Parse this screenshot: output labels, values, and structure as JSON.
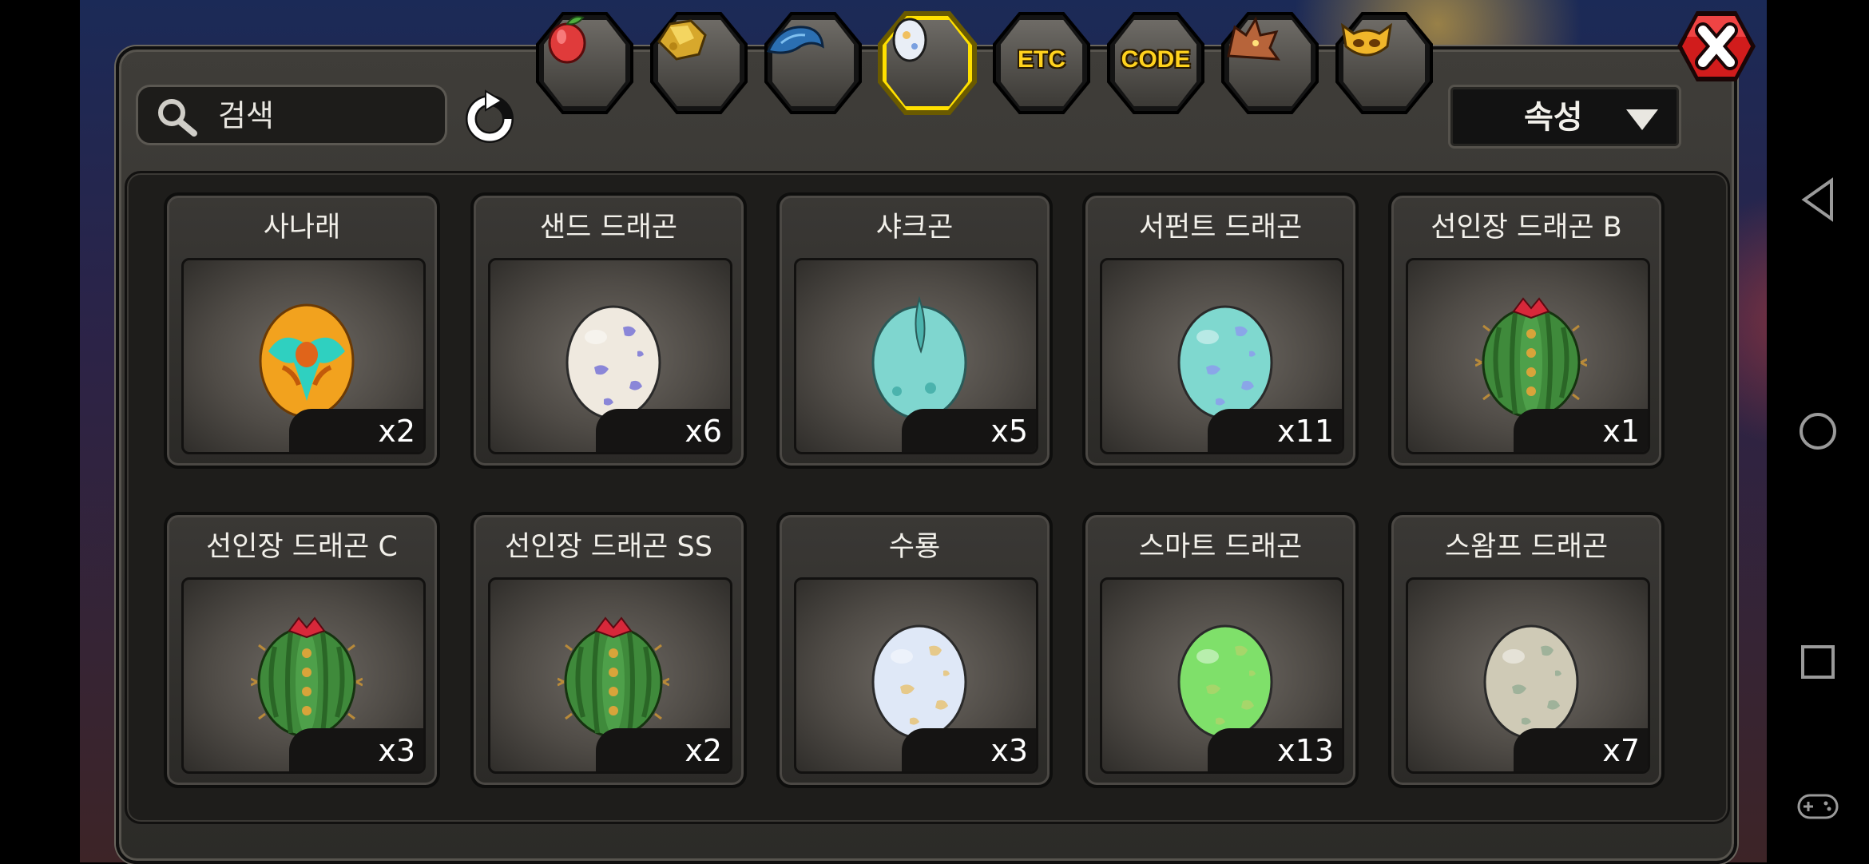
{
  "search": {
    "placeholder": "검색"
  },
  "sort": {
    "label": "속성"
  },
  "tabs": [
    {
      "id": "fruit",
      "icon": "fruit-icon",
      "text": "",
      "selected": false
    },
    {
      "id": "gold",
      "icon": "gold-ore-icon",
      "text": "",
      "selected": false
    },
    {
      "id": "dragon-scale",
      "icon": "blue-dragon-icon",
      "text": "",
      "selected": false
    },
    {
      "id": "egg",
      "icon": "egg-icon",
      "text": "",
      "selected": true
    },
    {
      "id": "etc",
      "icon": "",
      "text": "ETC",
      "selected": false
    },
    {
      "id": "code",
      "icon": "",
      "text": "CODE",
      "selected": false
    },
    {
      "id": "dragon",
      "icon": "dragon-head-icon",
      "text": "",
      "selected": false
    },
    {
      "id": "mask",
      "icon": "mask-icon",
      "text": "",
      "selected": false
    }
  ],
  "items": [
    {
      "name": "사나래",
      "count": "x2",
      "egg": {
        "base": "#f2a21e",
        "spot": "#2fd0c0",
        "style": "sanarae"
      }
    },
    {
      "name": "샌드 드래곤",
      "count": "x6",
      "egg": {
        "base": "#efe9df",
        "spot": "#8a86d8",
        "style": "spots"
      }
    },
    {
      "name": "샤크곤",
      "count": "x5",
      "egg": {
        "base": "#7fd6cf",
        "spot": "#4bb3ad",
        "style": "shark"
      }
    },
    {
      "name": "서펀트 드래곤",
      "count": "x11",
      "egg": {
        "base": "#7fd8cf",
        "spot": "#8aa6e8",
        "style": "spots"
      }
    },
    {
      "name": "선인장 드래곤 B",
      "count": "x1",
      "egg": {
        "base": "#3f8a3b",
        "spot": "#d8a43a",
        "style": "cactus"
      }
    },
    {
      "name": "선인장 드래곤 C",
      "count": "x3",
      "egg": {
        "base": "#3f8a3b",
        "spot": "#d8a43a",
        "style": "cactus"
      }
    },
    {
      "name": "선인장 드래곤 SS",
      "count": "x2",
      "egg": {
        "base": "#3f8a3b",
        "spot": "#d8a43a",
        "style": "cactus"
      }
    },
    {
      "name": "수룡",
      "count": "x3",
      "egg": {
        "base": "#dfe8f7",
        "spot": "#e6c98a",
        "style": "spots"
      }
    },
    {
      "name": "스마트 드래곤",
      "count": "x13",
      "egg": {
        "base": "#7fe06a",
        "spot": "#a6d66a",
        "style": "spots"
      }
    },
    {
      "name": "스왐프 드래곤",
      "count": "x7",
      "egg": {
        "base": "#cfcab6",
        "spot": "#9fb29a",
        "style": "spots"
      }
    }
  ]
}
